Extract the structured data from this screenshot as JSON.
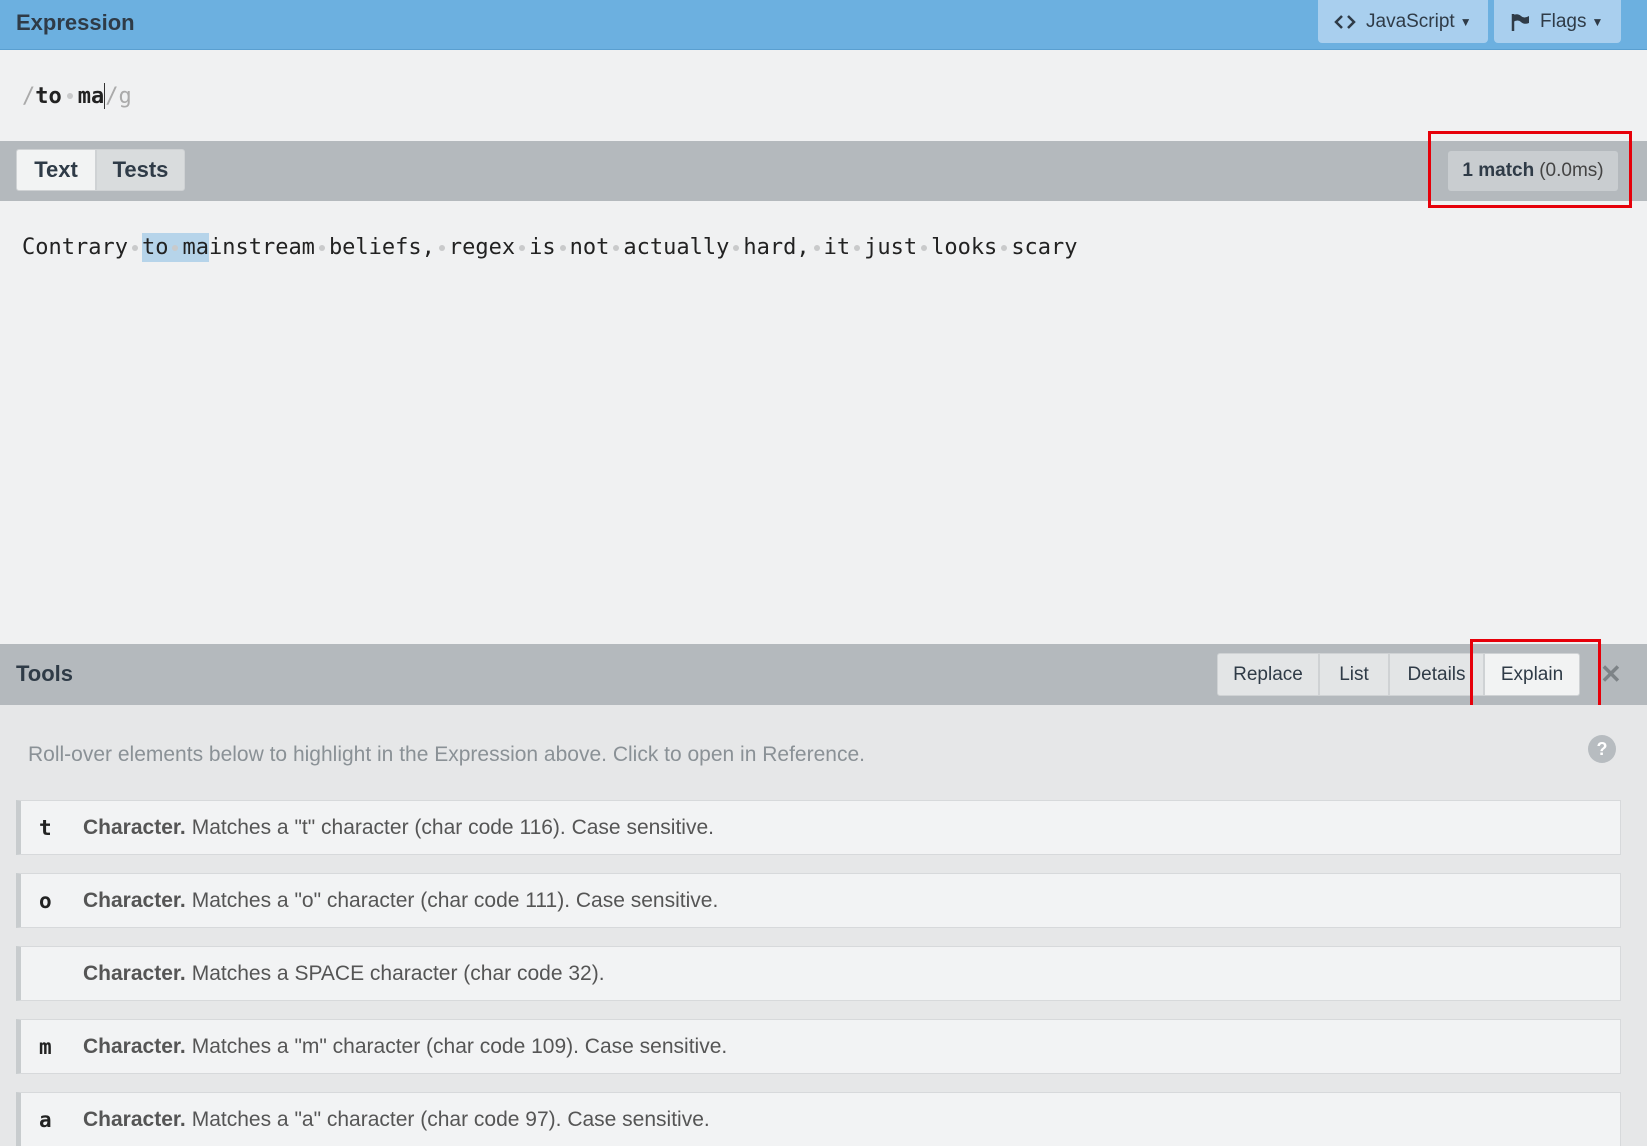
{
  "header": {
    "title": "Expression",
    "flavor_button": "JavaScript",
    "flags_button": "Flags"
  },
  "expression": {
    "open_delim": "/",
    "pattern_before": "to",
    "pattern_after": "ma",
    "close_delim": "/",
    "flags": "g"
  },
  "text_tabs": {
    "text": "Text",
    "tests": "Tests"
  },
  "match_status": {
    "count": "1 match",
    "time": "(0.0ms)"
  },
  "sample_text": {
    "words": [
      "Contrary"
    ],
    "match_pre": "to",
    "match_post": "ma",
    "rest_first": "instream",
    "rest_words": [
      "beliefs,",
      "regex",
      "is",
      "not",
      "actually",
      "hard,",
      "it",
      "just",
      "looks",
      "scary"
    ]
  },
  "tools": {
    "title": "Tools",
    "tabs": [
      "Replace",
      "List",
      "Details",
      "Explain"
    ],
    "close": "✕",
    "hint": "Roll-over elements below to highlight in the Expression above. Click to open in Reference.",
    "help": "?"
  },
  "explain_rows": [
    {
      "token": "t",
      "kind": "Character.",
      "desc": "Matches a \"t\" character (char code 116). Case sensitive."
    },
    {
      "token": "o",
      "kind": "Character.",
      "desc": "Matches a \"o\" character (char code 111). Case sensitive."
    },
    {
      "token": "",
      "kind": "Character.",
      "desc": "Matches a SPACE character (char code 32)."
    },
    {
      "token": "m",
      "kind": "Character.",
      "desc": "Matches a \"m\" character (char code 109). Case sensitive."
    },
    {
      "token": "a",
      "kind": "Character.",
      "desc": "Matches a \"a\" character (char code 97). Case sensitive."
    }
  ]
}
